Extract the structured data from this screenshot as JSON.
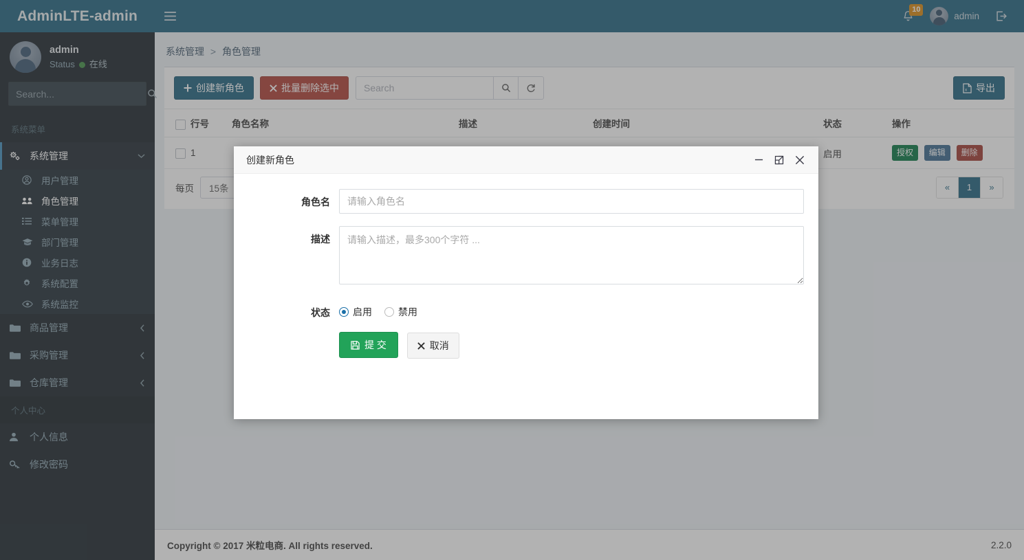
{
  "brand": {
    "title": "AdminLTE-admin"
  },
  "sidebar": {
    "user": {
      "name": "admin",
      "status_label": "Status",
      "status_value": "在线"
    },
    "search": {
      "placeholder": "Search...",
      "icon": "search-icon"
    },
    "menu_header": "系统菜单",
    "items": [
      {
        "label": "系统管理",
        "icon": "cogs-icon",
        "active": true,
        "arrow": "chevron-down-icon"
      },
      {
        "label": "商品管理",
        "icon": "folder-icon",
        "active": false,
        "arrow": "chevron-left-icon"
      },
      {
        "label": "采购管理",
        "icon": "folder-icon",
        "active": false,
        "arrow": "chevron-left-icon"
      },
      {
        "label": "仓库管理",
        "icon": "folder-icon",
        "active": false,
        "arrow": "chevron-left-icon"
      }
    ],
    "submenu": [
      {
        "label": "用户管理",
        "icon": "user-circle-icon",
        "active": false
      },
      {
        "label": "角色管理",
        "icon": "users-icon",
        "active": true
      },
      {
        "label": "菜单管理",
        "icon": "list-icon",
        "active": false
      },
      {
        "label": "部门管理",
        "icon": "graduation-cap-icon",
        "active": false
      },
      {
        "label": "业务日志",
        "icon": "info-circle-icon",
        "active": false
      },
      {
        "label": "系统配置",
        "icon": "gear-icon",
        "active": false
      },
      {
        "label": "系统监控",
        "icon": "eye-icon",
        "active": false
      }
    ],
    "section2_header": "个人中心",
    "section2_items": [
      {
        "label": "个人信息",
        "icon": "user-icon"
      },
      {
        "label": "修改密码",
        "icon": "key-icon"
      }
    ]
  },
  "navbar": {
    "toggle_icon": "hamburger-icon",
    "notifications": {
      "count": "10",
      "icon": "bell-icon"
    },
    "user_name": "admin",
    "logout_icon": "sign-out-icon"
  },
  "breadcrumb": {
    "parent": "系统管理",
    "separator": ">",
    "current": "角色管理"
  },
  "toolbar": {
    "create_label": "创建新角色",
    "create_icon": "plus-icon",
    "batch_delete_label": "批量删除选中",
    "batch_delete_icon": "times-icon",
    "search_placeholder": "Search",
    "search_icon": "search-icon",
    "refresh_icon": "refresh-icon",
    "export_label": "导出",
    "export_icon": "file-excel-icon"
  },
  "table": {
    "columns": [
      "行号",
      "角色名称",
      "描述",
      "创建时间",
      "状态",
      "操作"
    ],
    "rows": [
      {
        "num": "1",
        "name": "",
        "desc": "",
        "time": "",
        "state": "启用",
        "actions": [
          {
            "label": "授权",
            "color": "#00733e"
          },
          {
            "label": "编辑",
            "color": "#35658a"
          },
          {
            "label": "删除",
            "color": "#9e352c"
          }
        ]
      }
    ]
  },
  "pager": {
    "per_page_label": "每页",
    "per_page_value": "15条",
    "prev": "«",
    "pages": [
      "1"
    ],
    "next": "»"
  },
  "footer": {
    "copyright": "Copyright © 2017 米粒电商. All rights reserved.",
    "version": "2.2.0"
  },
  "modal": {
    "title": "创建新角色",
    "minimize_icon": "minimize-icon",
    "maximize_icon": "maximize-icon",
    "close_icon": "close-icon",
    "fields": {
      "role_name_label": "角色名",
      "role_name_placeholder": "请输入角色名",
      "role_name_value": "",
      "desc_label": "描述",
      "desc_placeholder": "请输入描述，最多300个字符 ...",
      "desc_value": "",
      "status_label": "状态",
      "status_options": [
        {
          "label": "启用",
          "selected": true
        },
        {
          "label": "禁用",
          "selected": false
        }
      ]
    },
    "submit_label": "提 交",
    "submit_icon": "save-icon",
    "cancel_label": "取消",
    "cancel_icon": "times-icon"
  },
  "colors": {
    "brand_bg": "#1b5f7d",
    "sidebar_bg": "#141e25",
    "content_bg": "#ecf0f5",
    "accent_blue": "#1b5f7d",
    "danger_red": "#ae3b30",
    "success_green": "#22a359",
    "badge_orange": "#d9860a"
  }
}
